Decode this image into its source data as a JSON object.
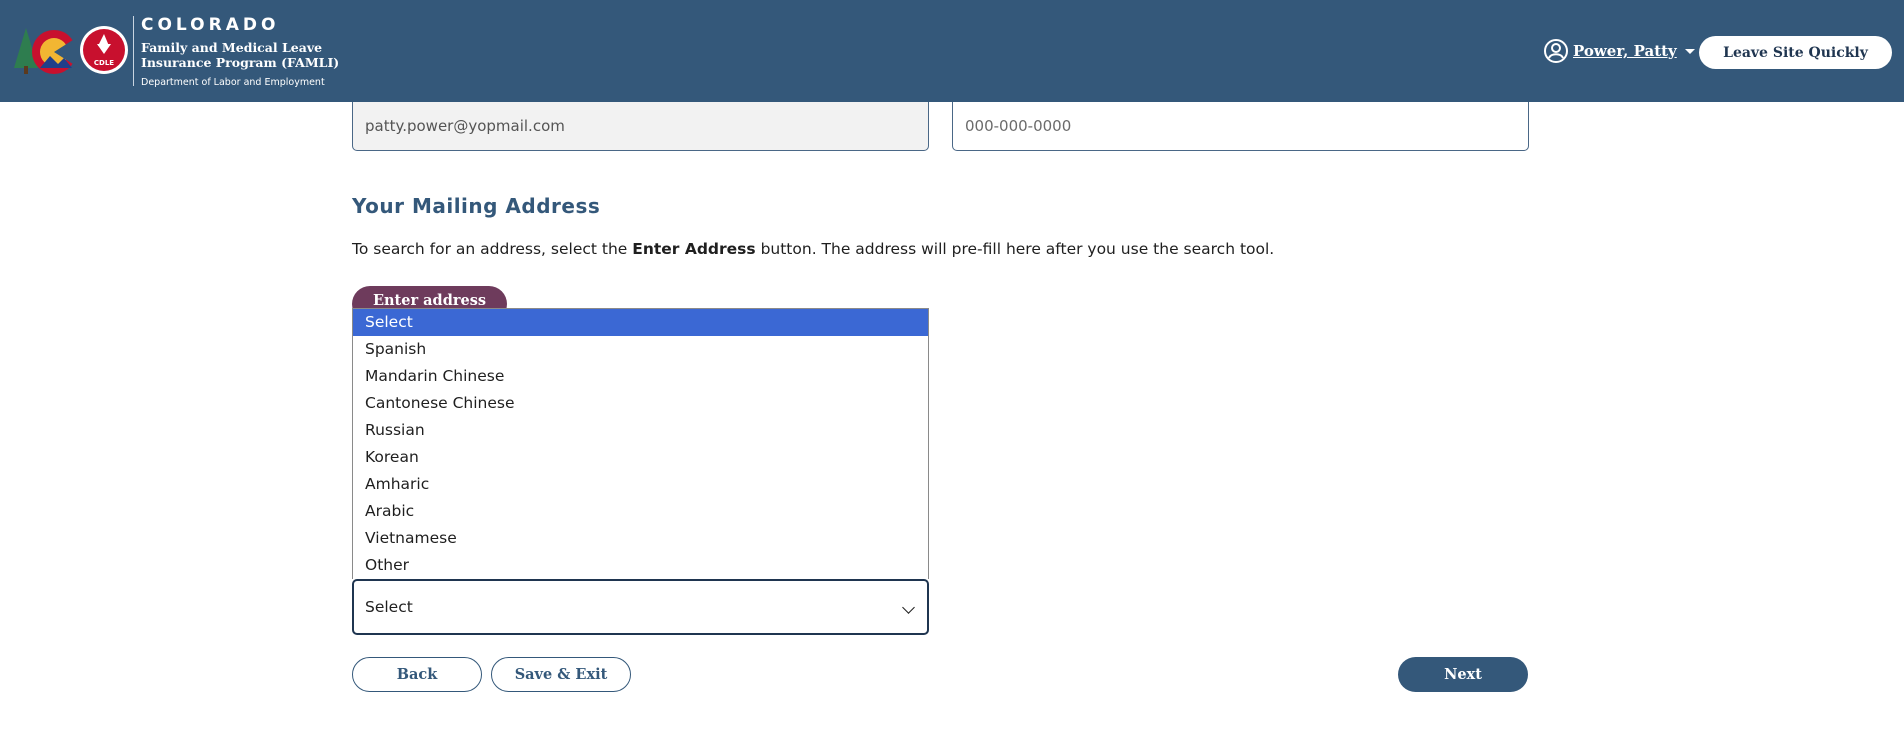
{
  "header": {
    "state_name": "COLORADO",
    "program_line1": "Family and Medical Leave",
    "program_line2": "Insurance Program (FAMLI)",
    "department": "Department of Labor and Employment",
    "cdle_badge": "CDLE",
    "user_name": "Power, Patty",
    "leave_button": "Leave Site Quickly"
  },
  "contact": {
    "email_value": "patty.power@yopmail.com",
    "phone_placeholder": "000-000-0000"
  },
  "mailing": {
    "title": "Your Mailing Address",
    "instructions_prefix": "To search for an address, select the ",
    "instructions_bold": "Enter Address",
    "instructions_suffix": " button. The address will pre-fill here after you use the search tool.",
    "enter_address_button": "Enter address"
  },
  "language_dropdown": {
    "options": [
      "Select",
      "Spanish",
      "Mandarin Chinese",
      "Cantonese Chinese",
      "Russian",
      "Korean",
      "Amharic",
      "Arabic",
      "Vietnamese",
      "Other"
    ],
    "highlighted_index": 0,
    "selected_value": "Select"
  },
  "footer_buttons": {
    "back": "Back",
    "save_exit": "Save & Exit",
    "next": "Next"
  },
  "colors": {
    "header_bg": "#34587a",
    "enter_button": "#6e3b5c",
    "option_highlight": "#3b68d4"
  }
}
